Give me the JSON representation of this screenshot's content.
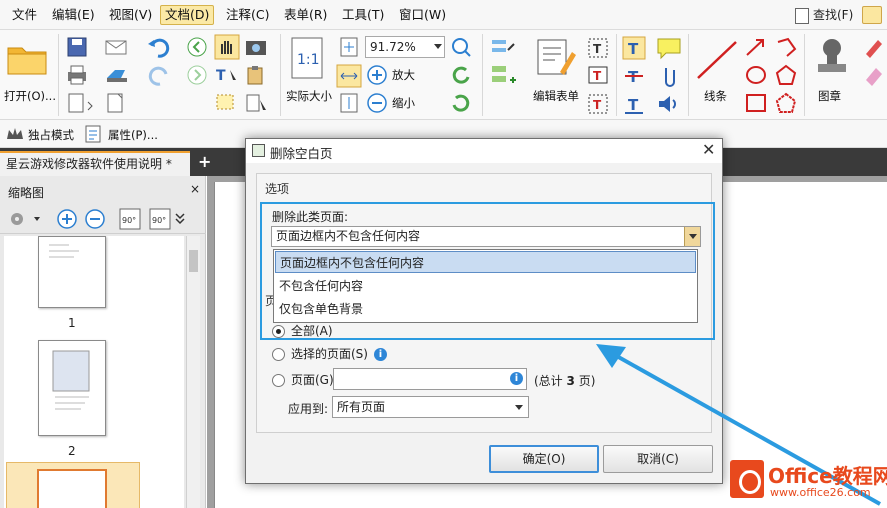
{
  "menubar": {
    "items": [
      "文件",
      "编辑(E)",
      "视图(V)",
      "文档(D)",
      "注释(C)",
      "表单(R)",
      "工具(T)",
      "窗口(W)"
    ],
    "active_index": 3,
    "find_label": "查找(F)"
  },
  "ribbon": {
    "open_label": "打开(O)...",
    "zoom_value": "91.72%",
    "zoom_in_label": "放大",
    "zoom_out_label": "缩小",
    "actual_size_label": "实际大小",
    "edit_form_label": "编辑表单",
    "lines_label": "线条",
    "stamp_label": "图章"
  },
  "toolbar2": {
    "exclusive_mode_label": "独占模式",
    "properties_label": "属性(P)..."
  },
  "tabs": {
    "doc_tab_label": "星云游戏修改器软件使用说明 *"
  },
  "left_panel": {
    "title": "缩略图",
    "page_labels": [
      "1",
      "2"
    ]
  },
  "dialog": {
    "title": "删除空白页",
    "options_group_label": "选项",
    "delete_type_label": "删除此类页面:",
    "selected_type": "页面边框内不包含任何内容",
    "type_options": [
      "页面边框内不包含任何内容",
      "不包含任何内容",
      "仅包含单色背景"
    ],
    "partial_group_label": "页",
    "radio_all": "全部(A)",
    "radio_selected": "选择的页面(S)",
    "radio_pages": "页面(G)",
    "pages_value": "",
    "total_prefix": "(总计",
    "total_count": "3",
    "total_suffix": "页)",
    "apply_to_label": "应用到:",
    "apply_to_value": "所有页面",
    "ok_label": "确定(O)",
    "cancel_label": "取消(C)"
  },
  "watermark": {
    "brand": "Office教程网",
    "url": "www.office26.com"
  },
  "colors": {
    "highlight_box": "#2b9be0",
    "arrow": "#2b9be0",
    "active_menu": "#fbe9a6",
    "watermark": "#e8491d"
  }
}
